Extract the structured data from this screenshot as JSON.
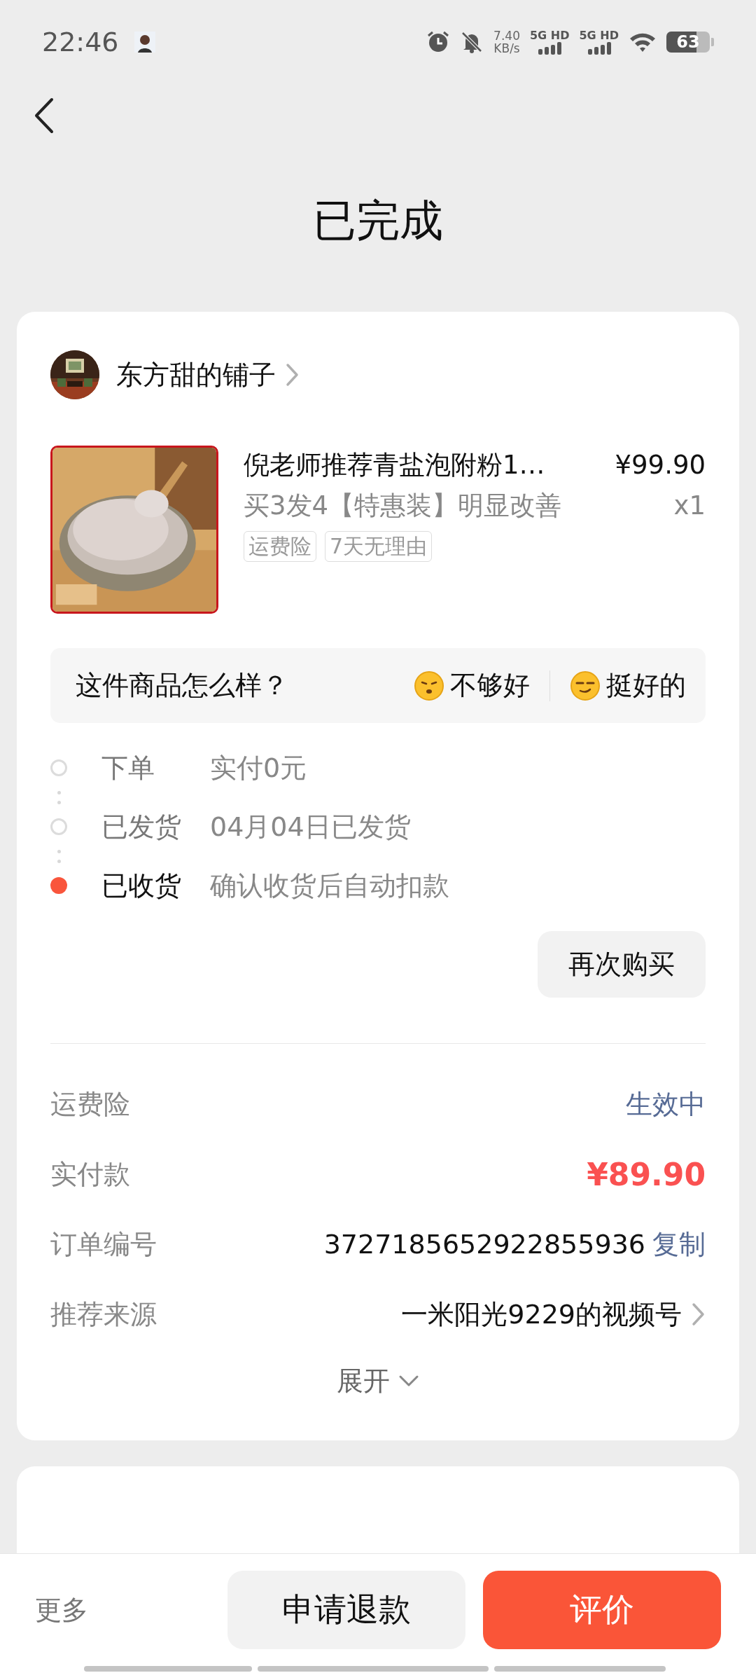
{
  "status_bar": {
    "time": "22:46",
    "net_speed": "7.40",
    "net_unit": "KB/s",
    "networks": [
      "5G HD",
      "5G HD"
    ],
    "battery": "63"
  },
  "header": {
    "title": "已完成"
  },
  "order": {
    "shop": {
      "name": "东方甜的铺子"
    },
    "product": {
      "title": "倪老师推荐青盐泡附粉1…",
      "spec": "买3发4【特惠装】明显改善",
      "price": "¥99.90",
      "quantity": "x1",
      "tags": [
        "运费险",
        "7天无理由"
      ]
    },
    "feedback": {
      "question": "这件商品怎么样？",
      "options": [
        {
          "kind": "bad",
          "label": "不够好"
        },
        {
          "kind": "good",
          "label": "挺好的"
        }
      ]
    },
    "timeline": [
      {
        "label": "下单",
        "detail": "实付0元",
        "selected": false
      },
      {
        "label": "已发货",
        "detail": "04月04日已发货",
        "selected": false
      },
      {
        "label": "已收货",
        "detail": "确认收货后自动扣款",
        "selected": true
      }
    ],
    "buy_again": "再次购买",
    "details": [
      {
        "kind": "status",
        "label": "运费险",
        "value": "生效中"
      },
      {
        "kind": "price",
        "label": "实付款",
        "value": "¥89.90"
      },
      {
        "kind": "copy",
        "label": "订单编号",
        "value": "3727185652922855936",
        "action": "复制"
      },
      {
        "kind": "link",
        "label": "推荐来源",
        "value": "一米阳光9229的视频号"
      }
    ],
    "expand": "展开"
  },
  "survey": {
    "kind": "card"
  },
  "bottom_bar": {
    "more": "更多",
    "buttons": [
      {
        "kind": "secondary",
        "label": "申请退款"
      },
      {
        "kind": "primary",
        "label": "评价"
      }
    ]
  }
}
